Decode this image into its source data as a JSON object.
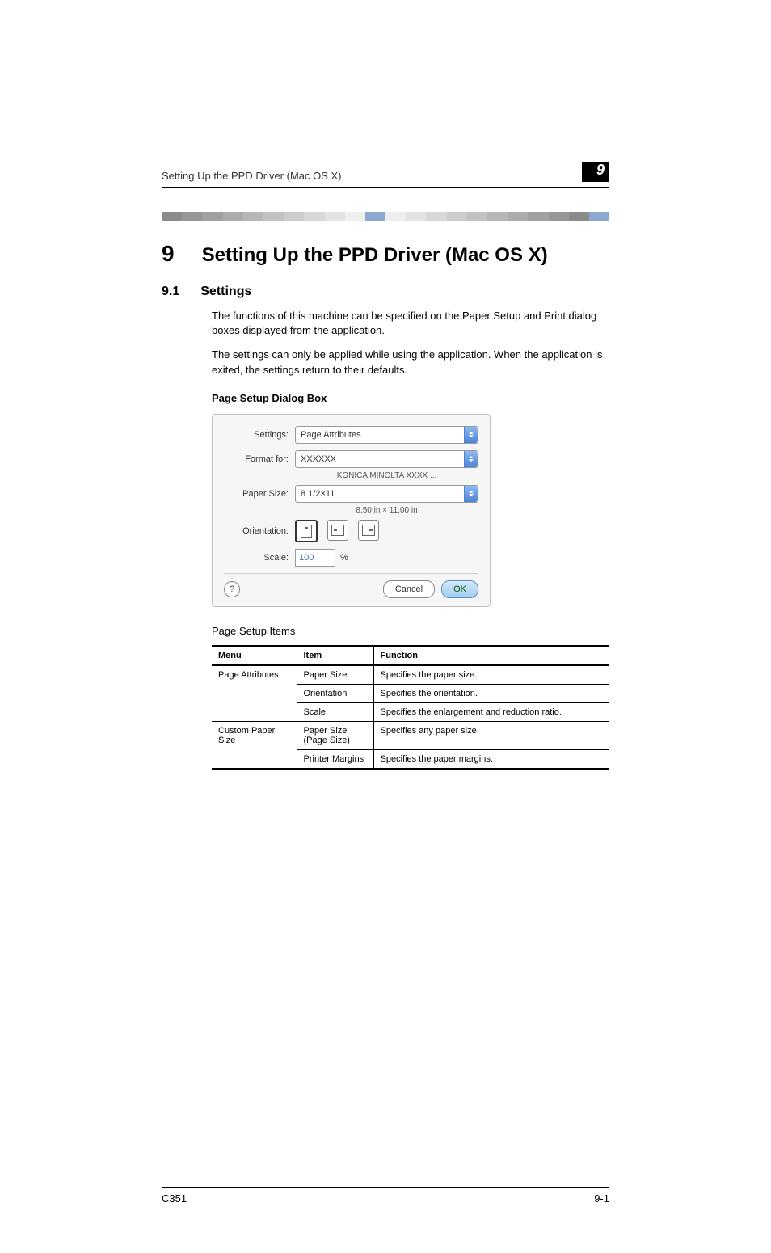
{
  "header": {
    "running": "Setting Up the PPD Driver (Mac OS X)",
    "chapter_badge": "9"
  },
  "h1": {
    "num": "9",
    "text": "Setting Up the PPD Driver (Mac OS X)"
  },
  "h2": {
    "num": "9.1",
    "text": "Settings"
  },
  "paras": {
    "p1": "The functions of this machine can be specified on the Paper Setup and Print dialog boxes displayed from the application.",
    "p2": "The settings can only be applied while using the application. When the application is exited, the settings return to their defaults."
  },
  "subhead": "Page Setup Dialog Box",
  "dialog": {
    "labels": {
      "settings": "Settings:",
      "format_for": "Format for:",
      "paper_size": "Paper Size:",
      "orientation": "Orientation:",
      "scale": "Scale:"
    },
    "values": {
      "settings": "Page Attributes",
      "format_for": "XXXXXX",
      "format_sub": "KONICA MINOLTA XXXX ...",
      "paper_size": "8 1/2×11",
      "paper_sub": "8.50 in × 11.00 in",
      "scale": "100",
      "scale_unit": "%"
    },
    "buttons": {
      "help": "?",
      "cancel": "Cancel",
      "ok": "OK"
    }
  },
  "caption": "Page Setup Items",
  "table": {
    "headers": {
      "menu": "Menu",
      "item": "Item",
      "function": "Function"
    },
    "rows": [
      {
        "menu": "Page Attributes",
        "item": "Paper Size",
        "fn": "Specifies the paper size."
      },
      {
        "menu": "",
        "item": "Orientation",
        "fn": "Specifies the orientation."
      },
      {
        "menu": "",
        "item": "Scale",
        "fn": "Specifies the enlargement and reduction ratio."
      },
      {
        "menu": "Custom Paper Size",
        "item": "Paper Size (Page Size)",
        "fn": "Specifies any paper size."
      },
      {
        "menu": "",
        "item": "Printer Margins",
        "fn": "Specifies the paper margins."
      }
    ]
  },
  "footer": {
    "left": "C351",
    "right": "9-1"
  },
  "gradbar_colors": [
    "#8b8b8b",
    "#969696",
    "#a1a1a1",
    "#acacac",
    "#b7b7b7",
    "#c2c2c2",
    "#cdcdcd",
    "#d8d8d8",
    "#e3e3e3",
    "#eeeeee",
    "#8ca8cc",
    "#eeeeee",
    "#e3e3e3",
    "#d8d8d8",
    "#cdcdcd",
    "#c2c2c2",
    "#b7b7b7",
    "#acacac",
    "#a1a1a1",
    "#969696",
    "#8b8b8b",
    "#8ca8cc"
  ]
}
